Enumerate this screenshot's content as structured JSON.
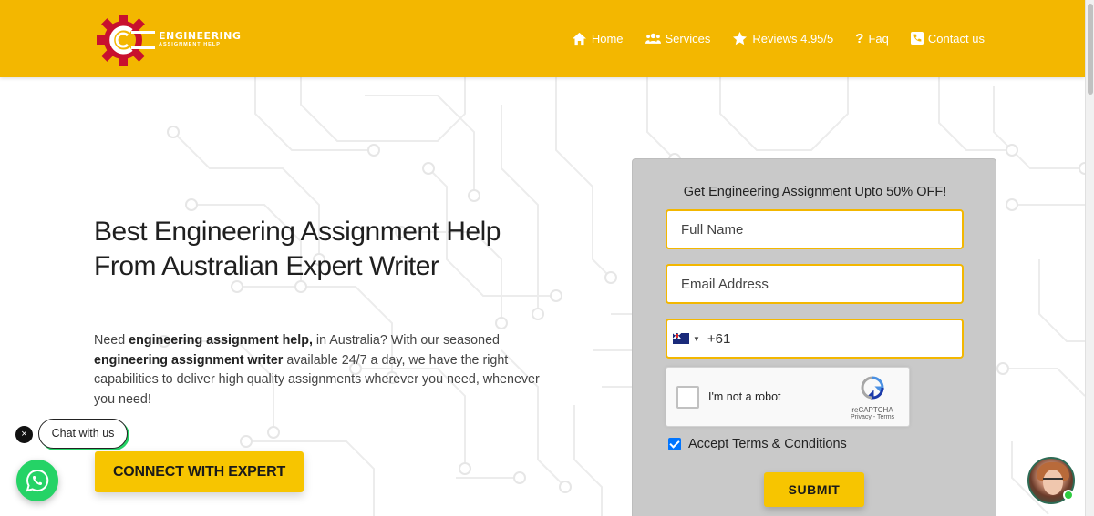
{
  "brand": {
    "name": "ENGINEERING",
    "tagline": "ASSIGNMENT HELP"
  },
  "nav": {
    "items": [
      {
        "label": "Home",
        "icon": "home-icon"
      },
      {
        "label": "Services",
        "icon": "users-icon"
      },
      {
        "label": "Reviews 4.95/5",
        "icon": "star-icon"
      },
      {
        "label": "Faq",
        "icon": "question-icon"
      },
      {
        "label": "Contact us",
        "icon": "phone-icon"
      }
    ]
  },
  "hero": {
    "title": "Best Engineering Assignment Help From Australian Expert Writer",
    "desc_part1": "Need ",
    "desc_bold1": "engineering assignment help,",
    "desc_part2": " in Australia? With our seasoned ",
    "desc_bold2": "engineering assignment writer",
    "desc_part3": " available 24/7 a day, we have the right capabilities to deliver high quality assignments wherever you need, whenever you need!",
    "cta_label": "CONNECT WITH EXPERT"
  },
  "chat": {
    "close_label": "×",
    "label": "Chat with us"
  },
  "form": {
    "title": "Get Engineering Assignment Upto 50% OFF!",
    "name_placeholder": "Full Name",
    "email_placeholder": "Email Address",
    "phone_code": "+61",
    "phone_country_caret": "▼",
    "captcha_label": "I'm not a robot",
    "captcha_brand": "reCAPTCHA",
    "captcha_links": "Privacy - Terms",
    "terms_label": "Accept Terms & Conditions",
    "terms_checked": true,
    "submit_label": "SUBMIT"
  },
  "colors": {
    "header": "#f3b700",
    "cta": "#f7c500",
    "whatsapp": "#25d366",
    "form_bg": "#c9c9c9"
  }
}
